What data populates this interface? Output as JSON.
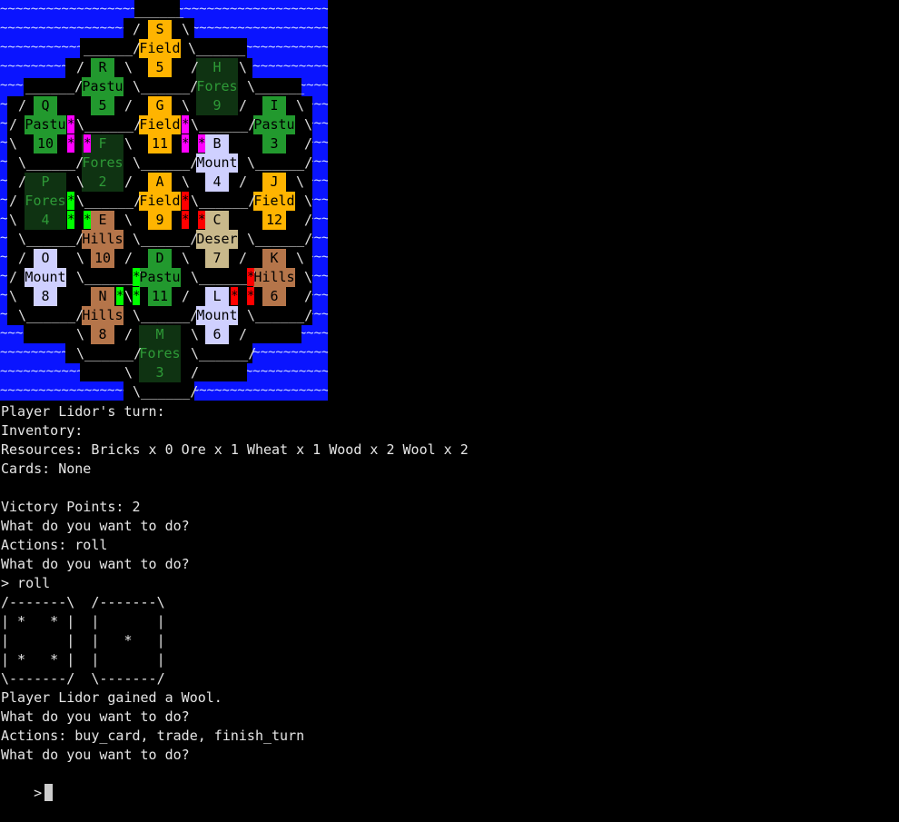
{
  "board": {
    "sea_pattern": "~~~~~~~~~~~~~~~~~~~~~~~~~~~~~~~~~~~~~~~~~~~~~~~~~~~~~~~~~~~~~~~~~~~~~~~~~~",
    "colors": {
      "sea": "#0a14ff",
      "field": "#ffb400",
      "pasture": "#22992e",
      "forest": "#0f3312",
      "forest_text": "#2e9a37",
      "hills": "#b5754a",
      "mountains": "#cfd0ff",
      "desert": "#c9b98b",
      "road_magenta": "#ff00ff",
      "road_green": "#00ff00",
      "road_red": "#ff0000"
    },
    "tiles": [
      {
        "letter": "S",
        "terrain": "Field",
        "number": "5",
        "type": "field"
      },
      {
        "letter": "R",
        "terrain": "Pastu",
        "number": "5",
        "type": "pasture"
      },
      {
        "letter": "H",
        "terrain": "Fores",
        "number": "9",
        "type": "forest"
      },
      {
        "letter": "Q",
        "terrain": "Pastu",
        "number": "10",
        "type": "pasture"
      },
      {
        "letter": "G",
        "terrain": "Field",
        "number": "11",
        "type": "field"
      },
      {
        "letter": "I",
        "terrain": "Pastu",
        "number": "3",
        "type": "pasture"
      },
      {
        "letter": "F",
        "terrain": "Fores",
        "number": "2",
        "type": "forest"
      },
      {
        "letter": "B",
        "terrain": "Mount",
        "number": "4",
        "type": "mountains"
      },
      {
        "letter": "P",
        "terrain": "Fores",
        "number": "4",
        "type": "forest"
      },
      {
        "letter": "A",
        "terrain": "Field",
        "number": "9",
        "type": "field"
      },
      {
        "letter": "J",
        "terrain": "Field",
        "number": "12",
        "type": "field"
      },
      {
        "letter": "E",
        "terrain": "Hills",
        "number": "10",
        "type": "hills"
      },
      {
        "letter": "C",
        "terrain": "Deser",
        "number": "7",
        "type": "desert"
      },
      {
        "letter": "O",
        "terrain": "Mount",
        "number": "8",
        "type": "mountains"
      },
      {
        "letter": "D",
        "terrain": "Pastu",
        "number": "11",
        "type": "pasture"
      },
      {
        "letter": "K",
        "terrain": "Hills",
        "number": "6",
        "type": "hills"
      },
      {
        "letter": "N",
        "terrain": "Hills",
        "number": "8",
        "type": "hills"
      },
      {
        "letter": "L",
        "terrain": "Mount",
        "number": "6",
        "type": "mountains"
      },
      {
        "letter": "M",
        "terrain": "Fores",
        "number": "3",
        "type": "forest"
      }
    ]
  },
  "console": {
    "lines": [
      "Player Lidor's turn:",
      "Inventory:",
      "Resources: Bricks x 0 Ore x 1 Wheat x 1 Wood x 2 Wool x 2",
      "Cards: None",
      "",
      "Victory Points: 2",
      "What do you want to do?",
      "Actions: roll",
      "What do you want to do?",
      "> roll",
      "/-------\\  /-------\\",
      "| *   * |  |       |",
      "|       |  |   *   |",
      "| *   * |  |       |",
      "\\-------/  \\-------/",
      "Player Lidor gained a Wool.",
      "What do you want to do?",
      "Actions: buy_card, trade, finish_turn",
      "What do you want to do?"
    ],
    "prompt": ">"
  }
}
